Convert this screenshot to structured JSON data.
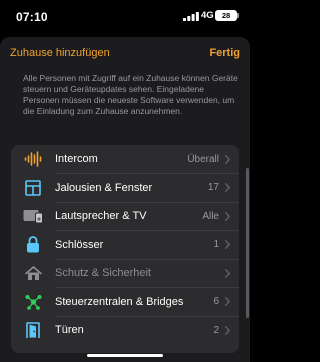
{
  "status_bar": {
    "time": "07:10",
    "network": "4G",
    "battery": "28"
  },
  "sheet": {
    "title": "Zuhause hinzufügen",
    "done_label": "Fertig",
    "description": "Alle Personen mit Zugriff auf ein Zuhause können Geräte steuern und Geräteupdates sehen. Eingeladene Personen müssen die neueste Software verwenden, um die Einladung zum Zuhause anzunehmen."
  },
  "list": {
    "items": [
      {
        "label": "Intercom",
        "value": "Überall",
        "icon": "intercom-waveform-icon",
        "color": "#f0a22e"
      },
      {
        "label": "Jalousien & Fenster",
        "value": "17",
        "icon": "window-icon",
        "color": "#5ac8fa"
      },
      {
        "label": "Lautsprecher & TV",
        "value": "Alle",
        "icon": "speaker-tv-icon",
        "color": "#8e8e93"
      },
      {
        "label": "Schlösser",
        "value": "1",
        "icon": "lock-icon",
        "color": "#5ac8fa"
      },
      {
        "label": "Schutz & Sicherheit",
        "value": "",
        "icon": "house-shield-icon",
        "color": "#8e8e93"
      },
      {
        "label": "Steuerzentralen & Bridges",
        "value": "6",
        "icon": "hub-icon",
        "color": "#30d158"
      },
      {
        "label": "Türen",
        "value": "2",
        "icon": "door-icon",
        "color": "#5ac8fa"
      }
    ]
  }
}
